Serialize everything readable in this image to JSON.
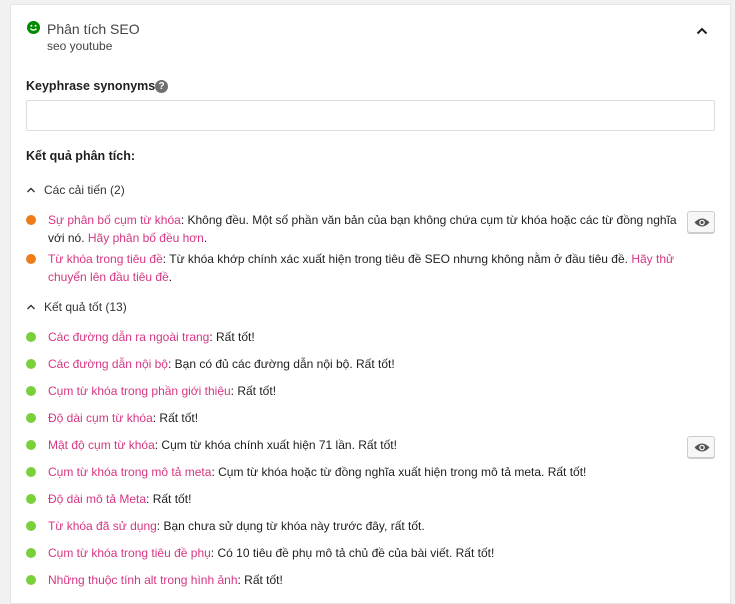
{
  "header": {
    "title": "Phân tích SEO",
    "keyphrase": "seo youtube"
  },
  "synonyms": {
    "label": "Keyphrase synonyms",
    "value": ""
  },
  "results_label": "Kết quả phân tích:",
  "improvements": {
    "label": "Các cải tiến (2)",
    "items": [
      {
        "link": "Sự phân bố cụm từ khóa",
        "text": ": Không đều. Một số phần văn bản của bạn không chứa cụm từ khóa hoặc các từ đồng nghĩa với nó. ",
        "link2": "Hãy phân bố đều hơn",
        "tail": "."
      },
      {
        "link": "Từ khóa trong tiêu đề",
        "text": ": Từ khóa khớp chính xác xuất hiện trong tiêu đề SEO nhưng không nằm ở đầu tiêu đề. ",
        "link2": "Hãy thử chuyển lên đầu tiêu đề",
        "tail": "."
      }
    ]
  },
  "good": {
    "label": "Kết quả tốt (13)",
    "items": [
      {
        "link": "Các đường dẫn ra ngoài trang",
        "text": ": Rất tốt!"
      },
      {
        "link": "Các đường dẫn nội bộ",
        "text": ": Bạn có đủ các đường dẫn nội bộ. Rất tốt!"
      },
      {
        "link": "Cụm từ khóa trong phần giới thiệu",
        "text": ": Rất tốt!"
      },
      {
        "link": "Độ dài cụm từ khóa",
        "text": ": Rất tốt!"
      },
      {
        "link": "Mật độ cụm từ khóa",
        "text": ": Cụm từ khóa chính xuất hiện 71 lần. Rất tốt!"
      },
      {
        "link": "Cụm từ khóa trong mô tả meta",
        "text": ": Cụm từ khóa hoặc từ đồng nghĩa xuất hiện trong mô tả meta. Rất tốt!"
      },
      {
        "link": "Độ dài mô tả Meta",
        "text": ": Rất tốt!"
      },
      {
        "link": "Từ khóa đã sử dụng",
        "text": ": Bạn chưa sử dụng từ khóa này trước đây, rất tốt."
      },
      {
        "link": "Cụm từ khóa trong tiêu đề phụ",
        "text": ": Có 10 tiêu đề phụ mô tả chủ đề của bài viết. Rất tốt!"
      },
      {
        "link": "Những thuộc tính alt trong hình ảnh",
        "text": ": Rất tốt!"
      }
    ]
  },
  "colors": {
    "problem": "#ee7c1b",
    "good": "#7ad03a",
    "link": "#d63683",
    "smile": "#008a00"
  }
}
